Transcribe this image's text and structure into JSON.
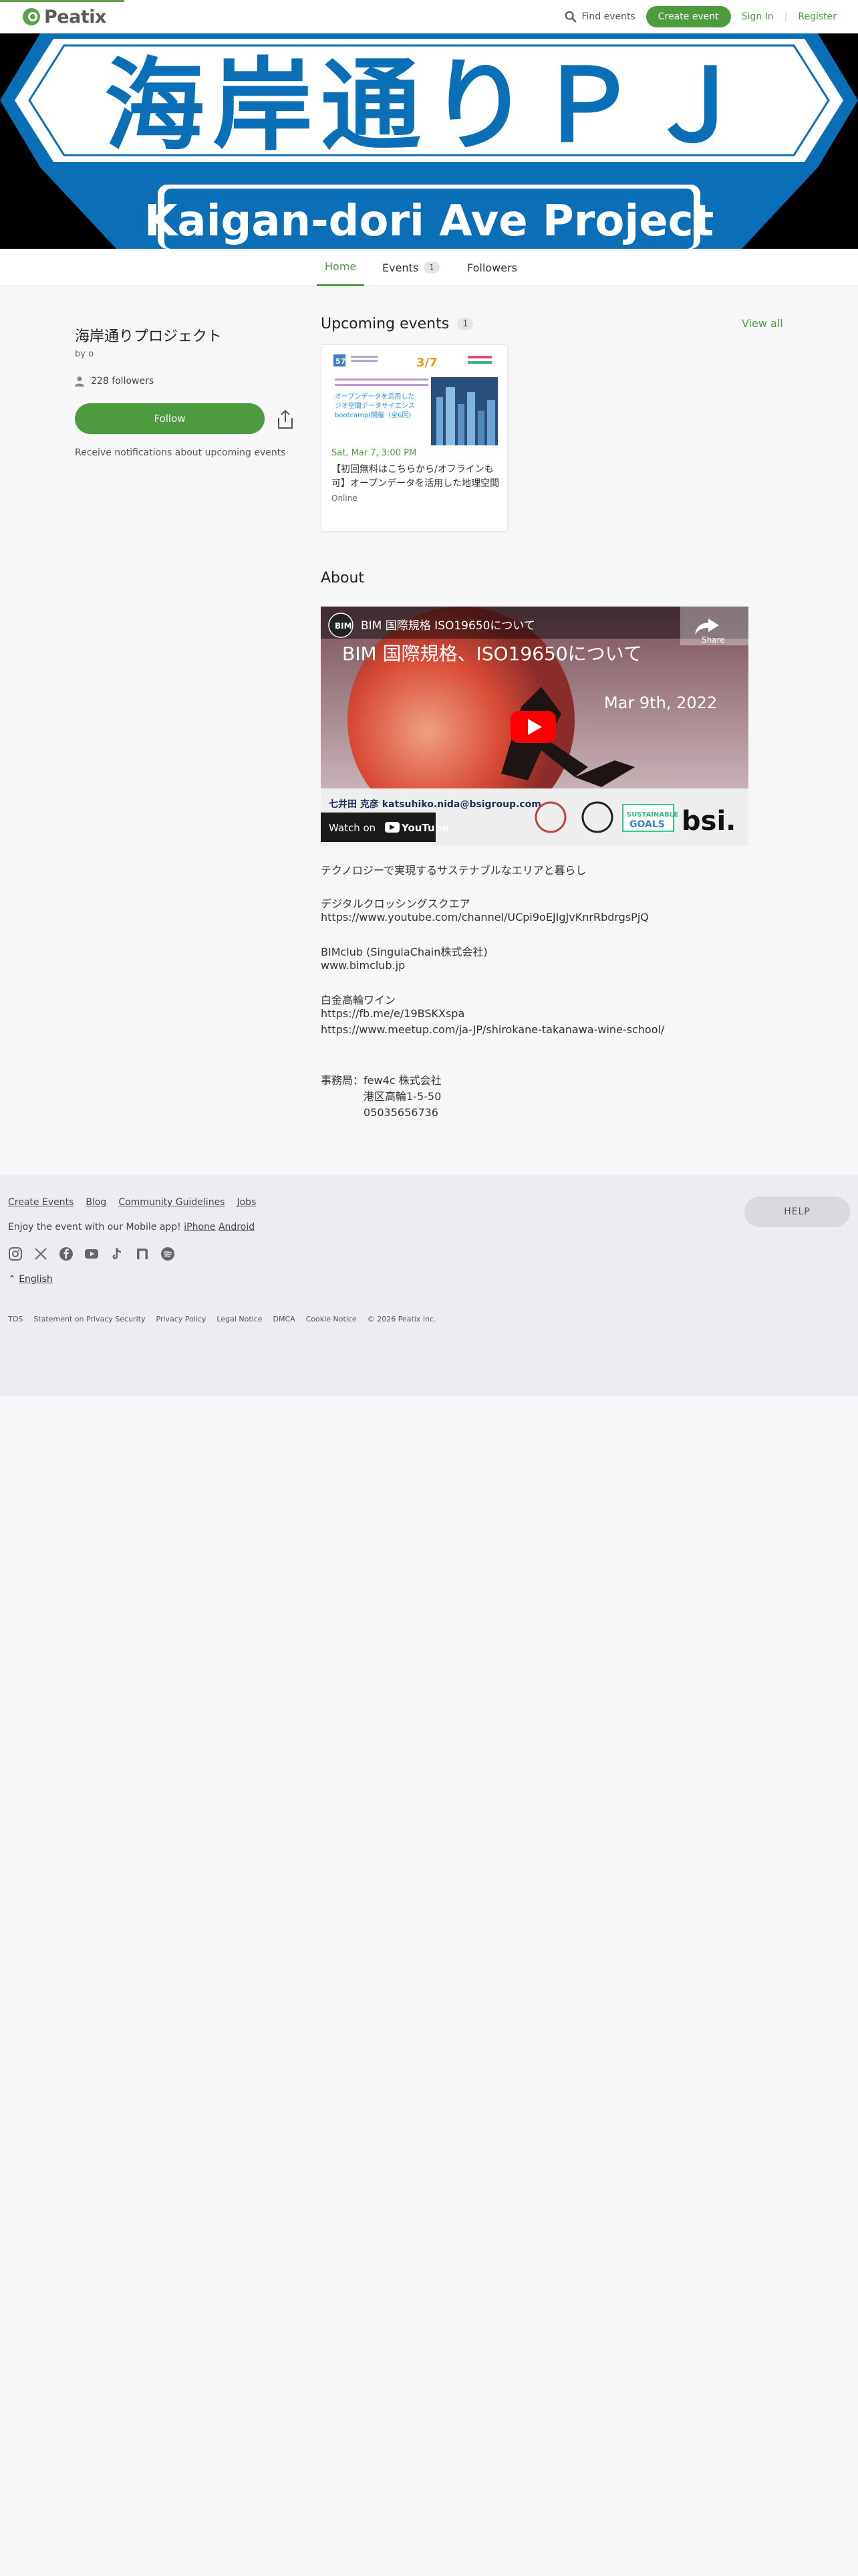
{
  "header": {
    "logo_text": "Peatix",
    "find_events": "Find events",
    "create_event": "Create event",
    "sign_in": "Sign In",
    "register": "Register",
    "separator": "|"
  },
  "banner": {
    "title_jp": "海岸通りＰＪ",
    "title_en": "Kaigan-dori Ave Project"
  },
  "tabs": [
    {
      "label": "Home",
      "active": true
    },
    {
      "label": "Events",
      "count": "1"
    },
    {
      "label": "Followers"
    }
  ],
  "organizer": {
    "name": "海岸通りプロジェクト",
    "by": "by o",
    "followers_count": "228",
    "followers_label": "followers",
    "follow_button": "Follow",
    "notify_text": "Receive notifications about upcoming events"
  },
  "upcoming": {
    "heading": "Upcoming events",
    "count": "1",
    "view_all": "View all",
    "events": [
      {
        "date": "Sat, Mar 7, 3:00 PM",
        "title": "【初回無料はこちらから/オフラインも可】オープンデータを活用した地理空間データサイエンスbootcamp",
        "location": "Online",
        "thumb_date": "3/7",
        "thumb_text": "オープンデータを活用した\nジオ空間データサイエンス\nbootcamp(開催（全6回)"
      }
    ]
  },
  "about": {
    "heading": "About",
    "video": {
      "channel_title": "BIM 国際規格 ISO19650について",
      "headline": "BIM 国際規格、ISO19650について",
      "date_text": "Mar 9th, 2022",
      "share_label": "Share",
      "watch_on": "Watch on",
      "youtube": "YouTube",
      "bsi_text": "bsi.",
      "sdg_text": "SUSTAINABLE DEVELOPMENT GOALS"
    },
    "lines": [
      "テクノロジーで実現するサステナブルなエリアと暮らし",
      "デジタルクロッシングスクエア",
      "https://www.youtube.com/channel/UCpi9oEJIgJvKnrRbdrgsPjQ",
      "BIMclub (SingulaChain株式会社)",
      "www.bimclub.jp",
      "白金高輪ワイン",
      "https://fb.me/e/19BSKXspa",
      "https://www.meetup.com/ja-JP/shirokane-takanawa-wine-school/",
      "事務局：few4c 株式会社",
      "　　　　港区高輪1-5-50",
      "　　　　05035656736"
    ]
  },
  "footer": {
    "links": [
      "Create Events",
      "Blog",
      "Community Guidelines",
      "Jobs"
    ],
    "app_text": "Enjoy the event with our Mobile app!",
    "iphone": "iPhone",
    "android": "Android",
    "language": "English",
    "legal": [
      "TOS",
      "Statement on Privacy Security",
      "Privacy Policy",
      "Legal Notice",
      "DMCA",
      "Cookie Notice",
      "© 2026 Peatix Inc."
    ],
    "help": "HELP"
  },
  "colors": {
    "brand_green": "#4d9a3f",
    "banner_blue": "#0b6fb8"
  }
}
